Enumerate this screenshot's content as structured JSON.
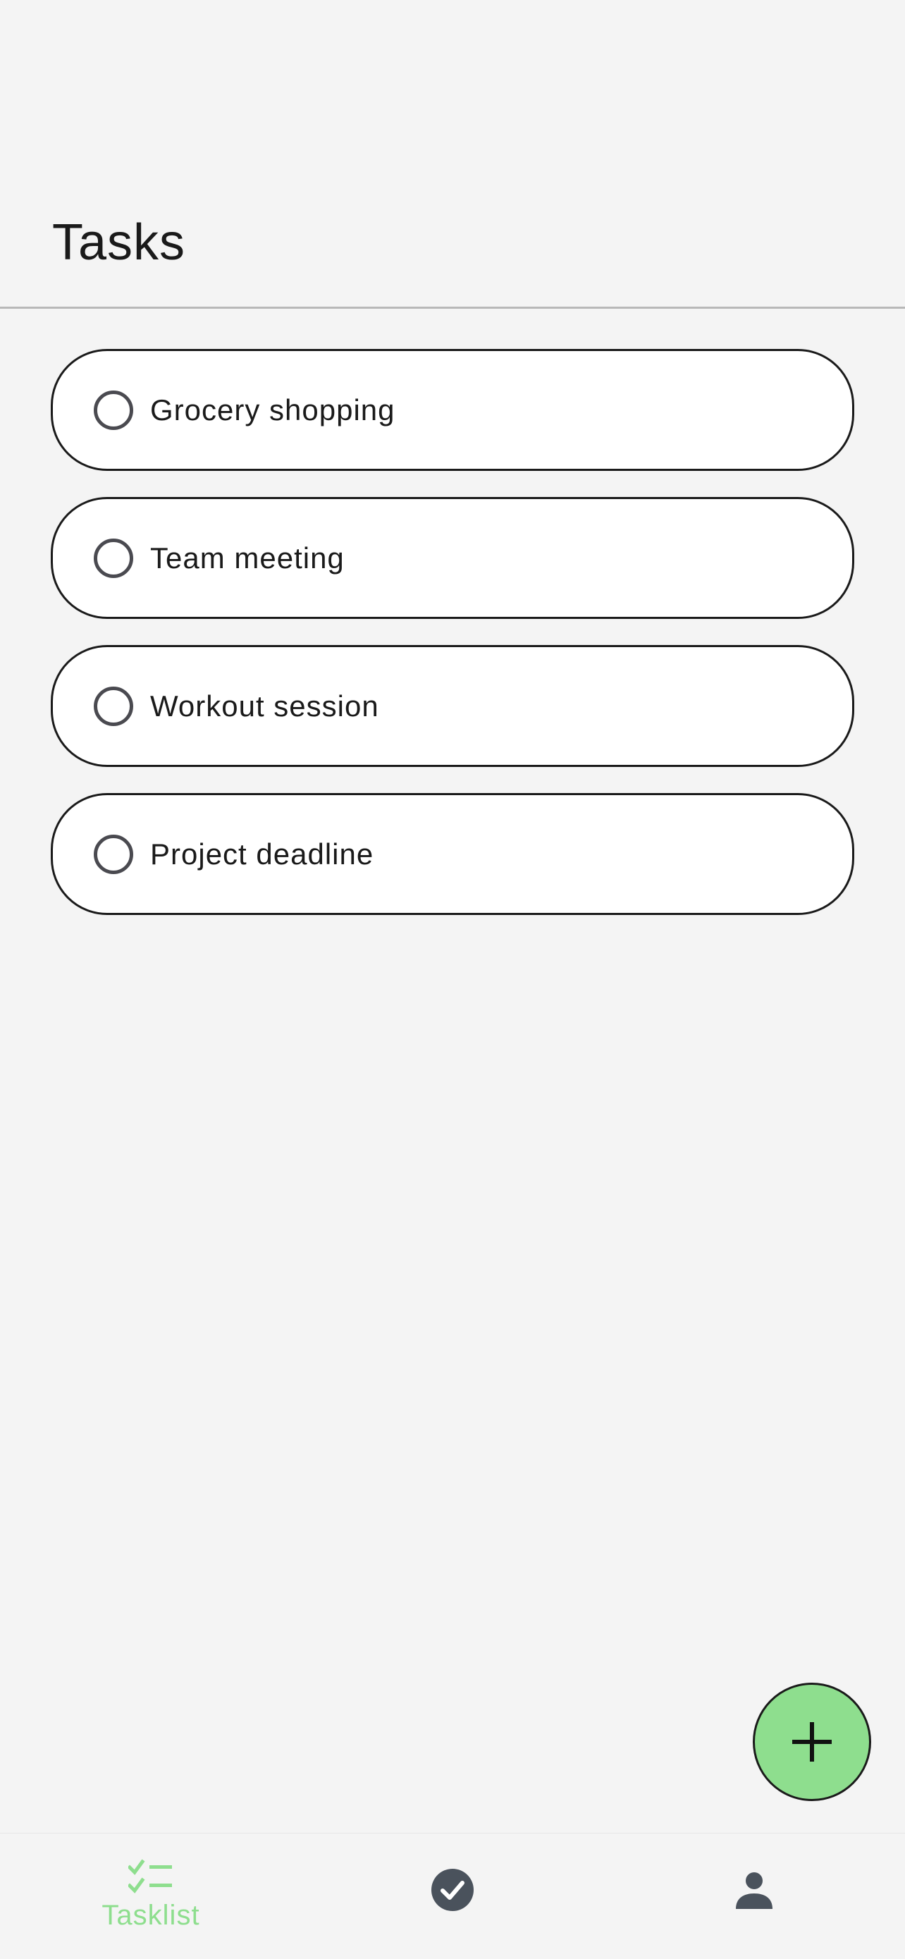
{
  "header": {
    "title": "Tasks"
  },
  "tasks": [
    {
      "label": "Grocery shopping",
      "completed": false
    },
    {
      "label": "Team meeting",
      "completed": false
    },
    {
      "label": "Workout session",
      "completed": false
    },
    {
      "label": "Project deadline",
      "completed": false
    }
  ],
  "fab": {
    "icon": "plus-icon",
    "color": "#8ede8e"
  },
  "bottom_nav": {
    "items": [
      {
        "label": "Tasklist",
        "icon": "checklist-icon",
        "active": true
      },
      {
        "label": "",
        "icon": "check-circle-icon",
        "active": false
      },
      {
        "label": "",
        "icon": "person-icon",
        "active": false
      }
    ],
    "active_color": "#8ede8e",
    "inactive_color": "#4a525c"
  }
}
